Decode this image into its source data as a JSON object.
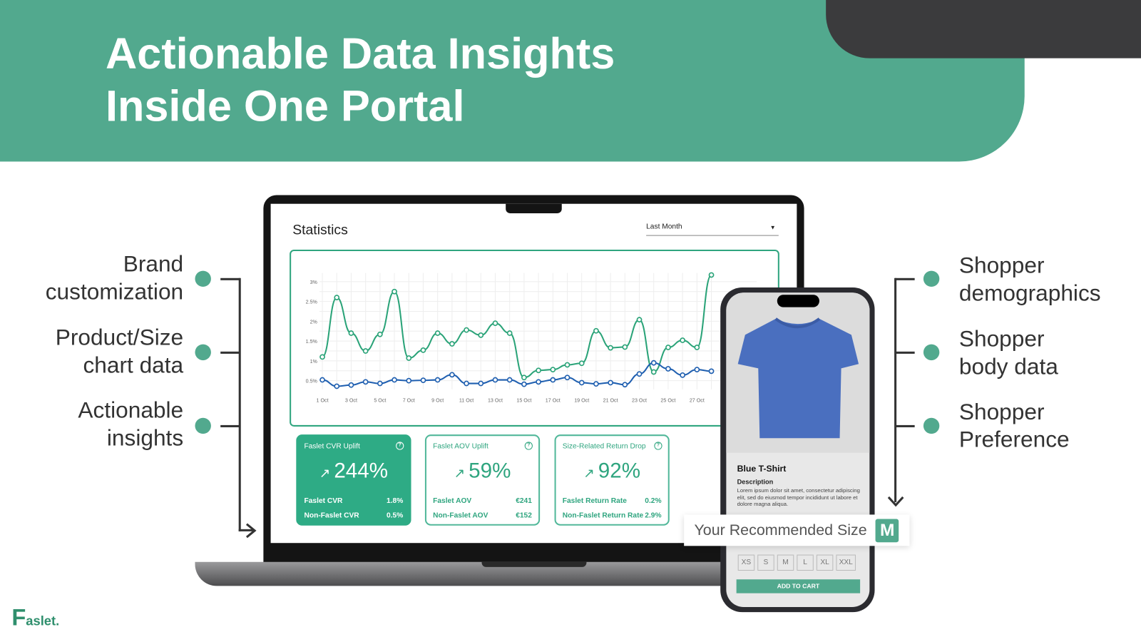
{
  "hero": {
    "title_line1": "Actionable Data Insights",
    "title_line2": "Inside One Portal"
  },
  "left_features": [
    "Brand customization",
    "Product/Size chart data",
    "Actionable insights"
  ],
  "left_features_lines": [
    [
      "Brand",
      "customization"
    ],
    [
      "Product/Size",
      "chart data"
    ],
    [
      "Actionable",
      "insights"
    ]
  ],
  "right_features_lines": [
    [
      "Shopper",
      "demographics"
    ],
    [
      "Shopper",
      "body data"
    ],
    [
      "Shopper",
      "Preference"
    ]
  ],
  "dashboard": {
    "title": "Statistics",
    "period_select": "Last Month",
    "cards": [
      {
        "title": "Faslet CVR Uplift",
        "value": "244%",
        "rows": [
          [
            "Faslet CVR",
            "1.8%"
          ],
          [
            "Non-Faslet CVR",
            "0.5%"
          ]
        ]
      },
      {
        "title": "Faslet AOV Uplift",
        "value": "59%",
        "rows": [
          [
            "Faslet AOV",
            "€241"
          ],
          [
            "Non-Faslet AOV",
            "€152"
          ]
        ]
      },
      {
        "title": "Size-Related Return Drop",
        "value": "92%",
        "rows": [
          [
            "Faslet Return Rate",
            "0.2%"
          ],
          [
            "Non-Faslet Return Rate",
            "2.9%"
          ]
        ]
      }
    ]
  },
  "chart_data": {
    "type": "line",
    "x": [
      "1 Oct",
      "2 Oct",
      "3 Oct",
      "4 Oct",
      "5 Oct",
      "6 Oct",
      "7 Oct",
      "8 Oct",
      "9 Oct",
      "10 Oct",
      "11 Oct",
      "12 Oct",
      "13 Oct",
      "14 Oct",
      "15 Oct",
      "16 Oct",
      "17 Oct",
      "18 Oct",
      "19 Oct",
      "20 Oct",
      "21 Oct",
      "22 Oct",
      "23 Oct",
      "24 Oct",
      "25 Oct",
      "26 Oct",
      "27 Oct",
      "28 Oct"
    ],
    "xticks": [
      "1 Oct",
      "3 Oct",
      "5 Oct",
      "7 Oct",
      "9 Oct",
      "11 Oct",
      "13 Oct",
      "15 Oct",
      "17 Oct",
      "19 Oct",
      "21 Oct",
      "23 Oct",
      "25 Oct",
      "27 Oct"
    ],
    "yticks": [
      "0.5%",
      "1%",
      "1.5%",
      "2%",
      "2.5%",
      "3%"
    ],
    "ylim": [
      0.3,
      3.2
    ],
    "grid": true,
    "series": [
      {
        "color": "#2aa378",
        "values": [
          1.1,
          2.6,
          1.7,
          1.25,
          1.67,
          2.75,
          1.07,
          1.27,
          1.7,
          1.43,
          1.78,
          1.65,
          1.95,
          1.7,
          0.58,
          0.76,
          0.78,
          0.9,
          0.94,
          1.76,
          1.33,
          1.35,
          2.04,
          0.72,
          1.34,
          1.52,
          1.34,
          3.17
        ]
      },
      {
        "color": "#1f5fb0",
        "values": [
          0.52,
          0.36,
          0.39,
          0.47,
          0.43,
          0.52,
          0.5,
          0.51,
          0.52,
          0.65,
          0.43,
          0.43,
          0.52,
          0.52,
          0.41,
          0.47,
          0.52,
          0.58,
          0.45,
          0.42,
          0.45,
          0.4,
          0.67,
          0.95,
          0.8,
          0.64,
          0.78,
          0.74
        ]
      }
    ]
  },
  "phone": {
    "product_name": "Blue T-Shirt",
    "description_label": "Description",
    "description": "Lorem ipsum dolor sit amet, consectetur adipiscing elit, sed do eiusmod tempor incididunt ut labore et dolore magna aliqua.",
    "sizes": [
      "XS",
      "S",
      "M",
      "L",
      "XL",
      "XXL"
    ],
    "add_to_cart": "ADD TO CART",
    "recommended_label": "Your Recommended Size",
    "recommended_size": "M"
  },
  "brand": {
    "logo": "Faslet.",
    "accent": "#52a98e"
  }
}
